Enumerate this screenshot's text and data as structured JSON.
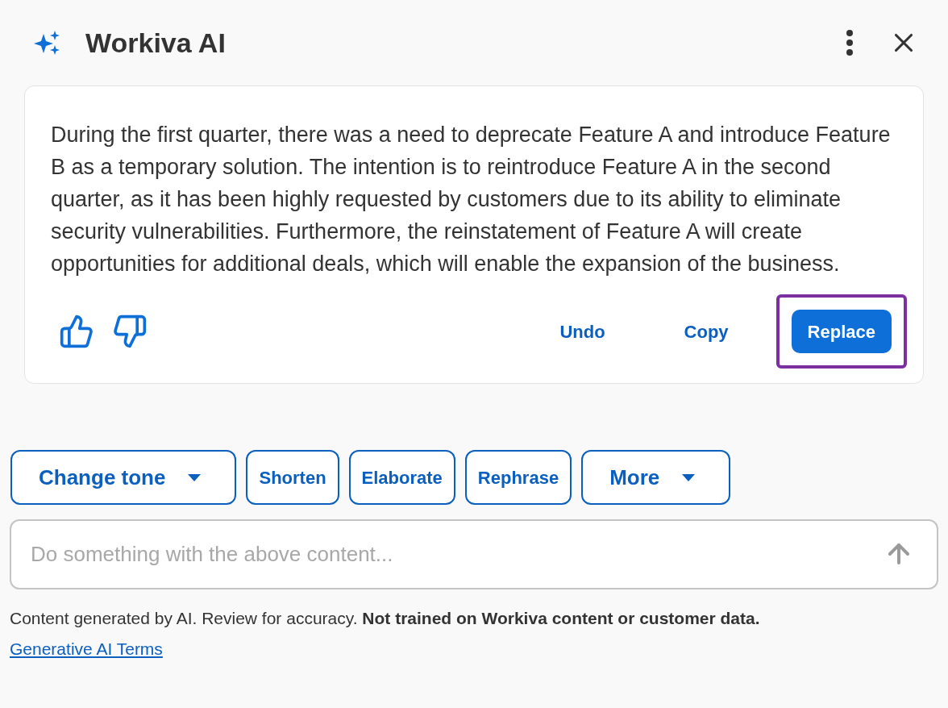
{
  "header": {
    "title": "Workiva AI"
  },
  "response": {
    "text": "During the first quarter, there was a need to deprecate Feature A and introduce Feature B as a temporary solution. The intention is to reintroduce Feature A in the second quarter, as it has been highly requested by customers due to its ability to eliminate security vulnerabilities. Furthermore, the reinstatement of Feature A will create opportunities for additional deals, which will enable the expansion of the business.",
    "actions": [
      {
        "label": "Undo",
        "kind": "link",
        "highlighted": false
      },
      {
        "label": "Copy",
        "kind": "link",
        "highlighted": false
      },
      {
        "label": "Replace",
        "kind": "primary",
        "highlighted": true
      }
    ]
  },
  "chips": [
    {
      "label": "Change tone",
      "kind": "dropdown"
    },
    {
      "label": "Shorten",
      "kind": "plain"
    },
    {
      "label": "Elaborate",
      "kind": "plain"
    },
    {
      "label": "Rephrase",
      "kind": "plain"
    },
    {
      "label": "More",
      "kind": "dropdown"
    }
  ],
  "prompt": {
    "placeholder": "Do something with the above content..."
  },
  "footer": {
    "disclaimer": "Content generated by AI. Review for accuracy. **Not trained on Workiva content or customer data.**",
    "link": "Generative AI Terms"
  }
}
